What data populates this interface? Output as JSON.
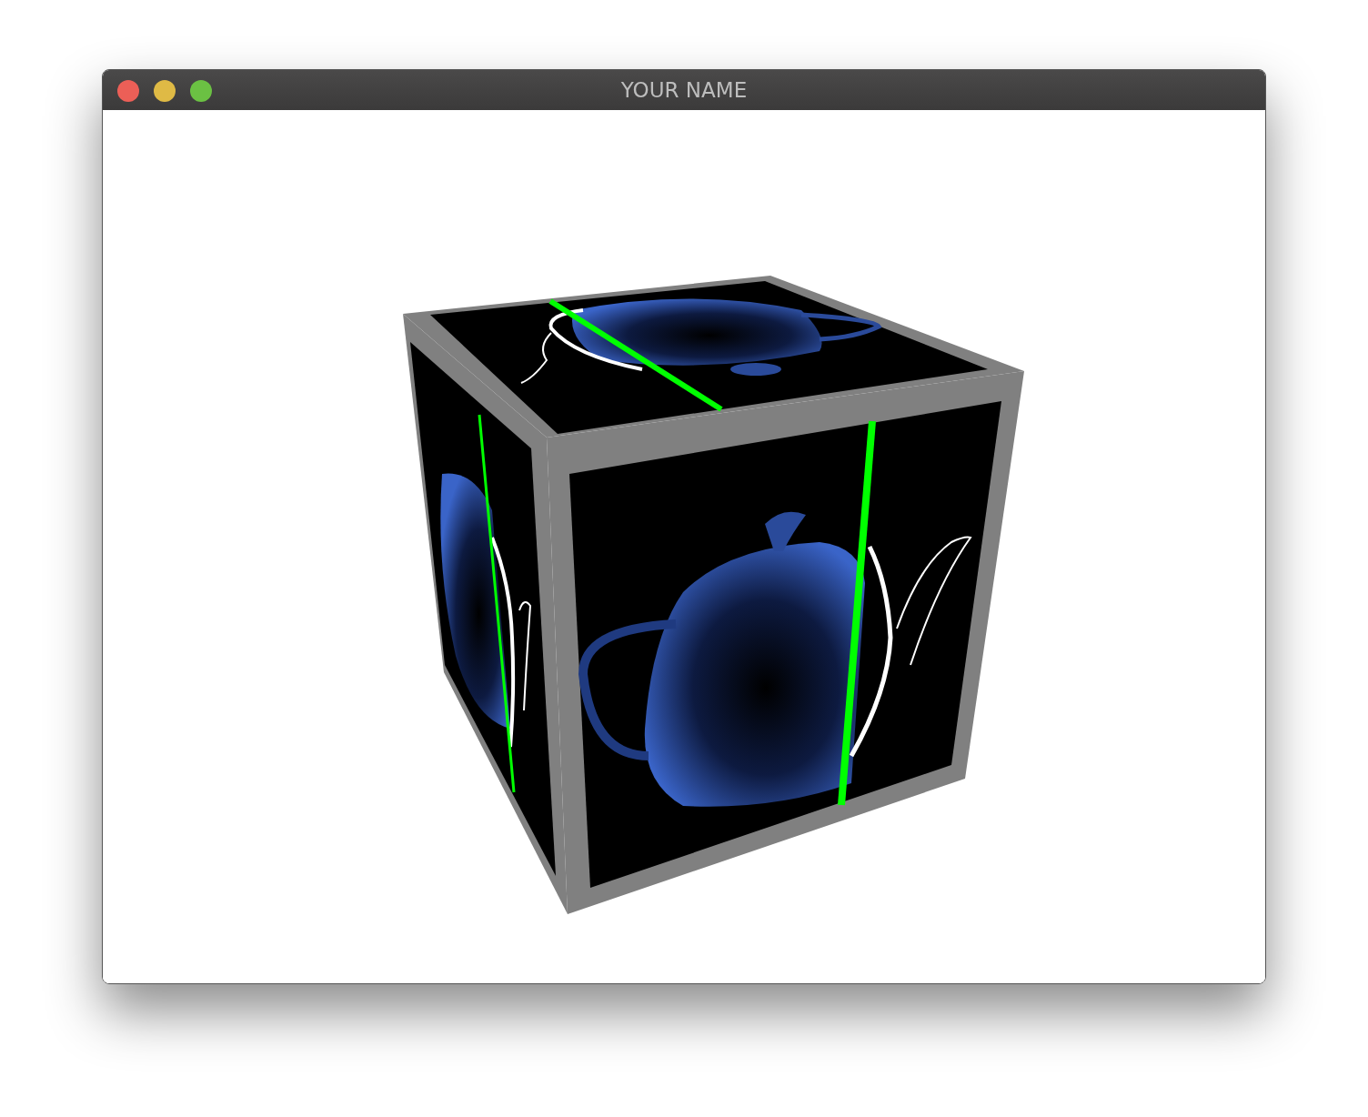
{
  "window": {
    "title": "YOUR NAME"
  }
}
